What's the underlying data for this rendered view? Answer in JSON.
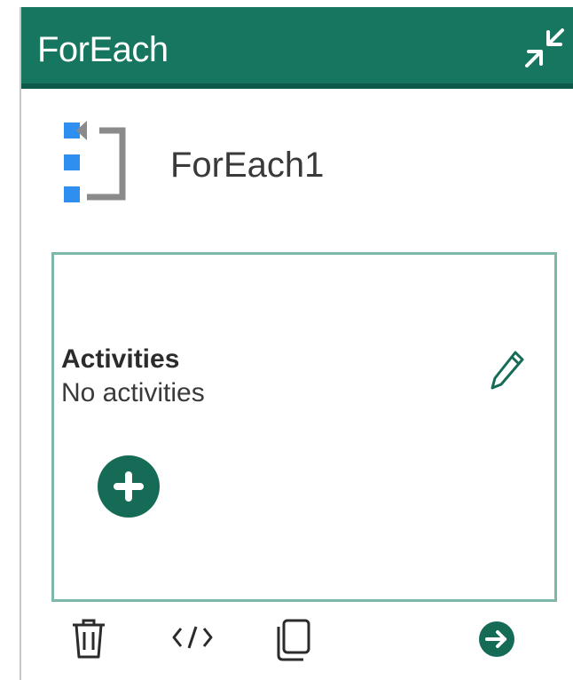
{
  "header": {
    "title": "ForEach",
    "collapse_icon": "collapse-arrows-icon"
  },
  "activity": {
    "name": "ForEach1",
    "icon": "foreach-loop-icon"
  },
  "activities_panel": {
    "title": "Activities",
    "subtitle": "No activities",
    "edit_icon": "pencil-icon",
    "add_icon": "plus-circle-icon"
  },
  "toolbar": {
    "delete_icon": "trash-icon",
    "code_icon": "code-icon",
    "copy_icon": "copy-icon",
    "navigate_icon": "arrow-right-circle-icon"
  },
  "colors": {
    "header_bg": "#16765f",
    "accent": "#166b57",
    "panel_border": "#7fb8aa",
    "icon_blue": "#2f8ff0",
    "icon_gray": "#8a8a8a"
  }
}
